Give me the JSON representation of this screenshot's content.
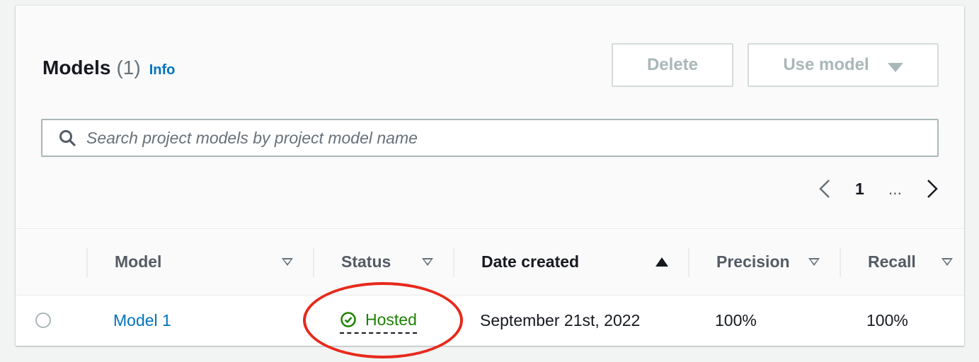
{
  "header": {
    "title": "Models",
    "count": "(1)",
    "info_label": "Info"
  },
  "actions": {
    "delete_label": "Delete",
    "use_model_label": "Use model"
  },
  "search": {
    "placeholder": "Search project models by project model name",
    "value": ""
  },
  "pagination": {
    "current_page": "1",
    "ellipsis": "..."
  },
  "table": {
    "columns": [
      {
        "label": "Model",
        "sort": "none"
      },
      {
        "label": "Status",
        "sort": "none"
      },
      {
        "label": "Date created",
        "sort": "ascending"
      },
      {
        "label": "Precision",
        "sort": "none"
      },
      {
        "label": "Recall",
        "sort": "none"
      }
    ],
    "rows": [
      {
        "model": "Model 1",
        "status": "Hosted",
        "date_created": "September 21st, 2022",
        "precision": "100%",
        "recall": "100%"
      }
    ]
  },
  "colors": {
    "link": "#0073bb",
    "status_success": "#1d8102",
    "annotation": "#e8291c",
    "disabled": "#aab7b8"
  },
  "icons": {
    "search": "search-icon",
    "prev": "chevron-left-icon",
    "next": "chevron-right-icon",
    "status": "check-circle-icon",
    "dropdown": "caret-down-icon"
  }
}
